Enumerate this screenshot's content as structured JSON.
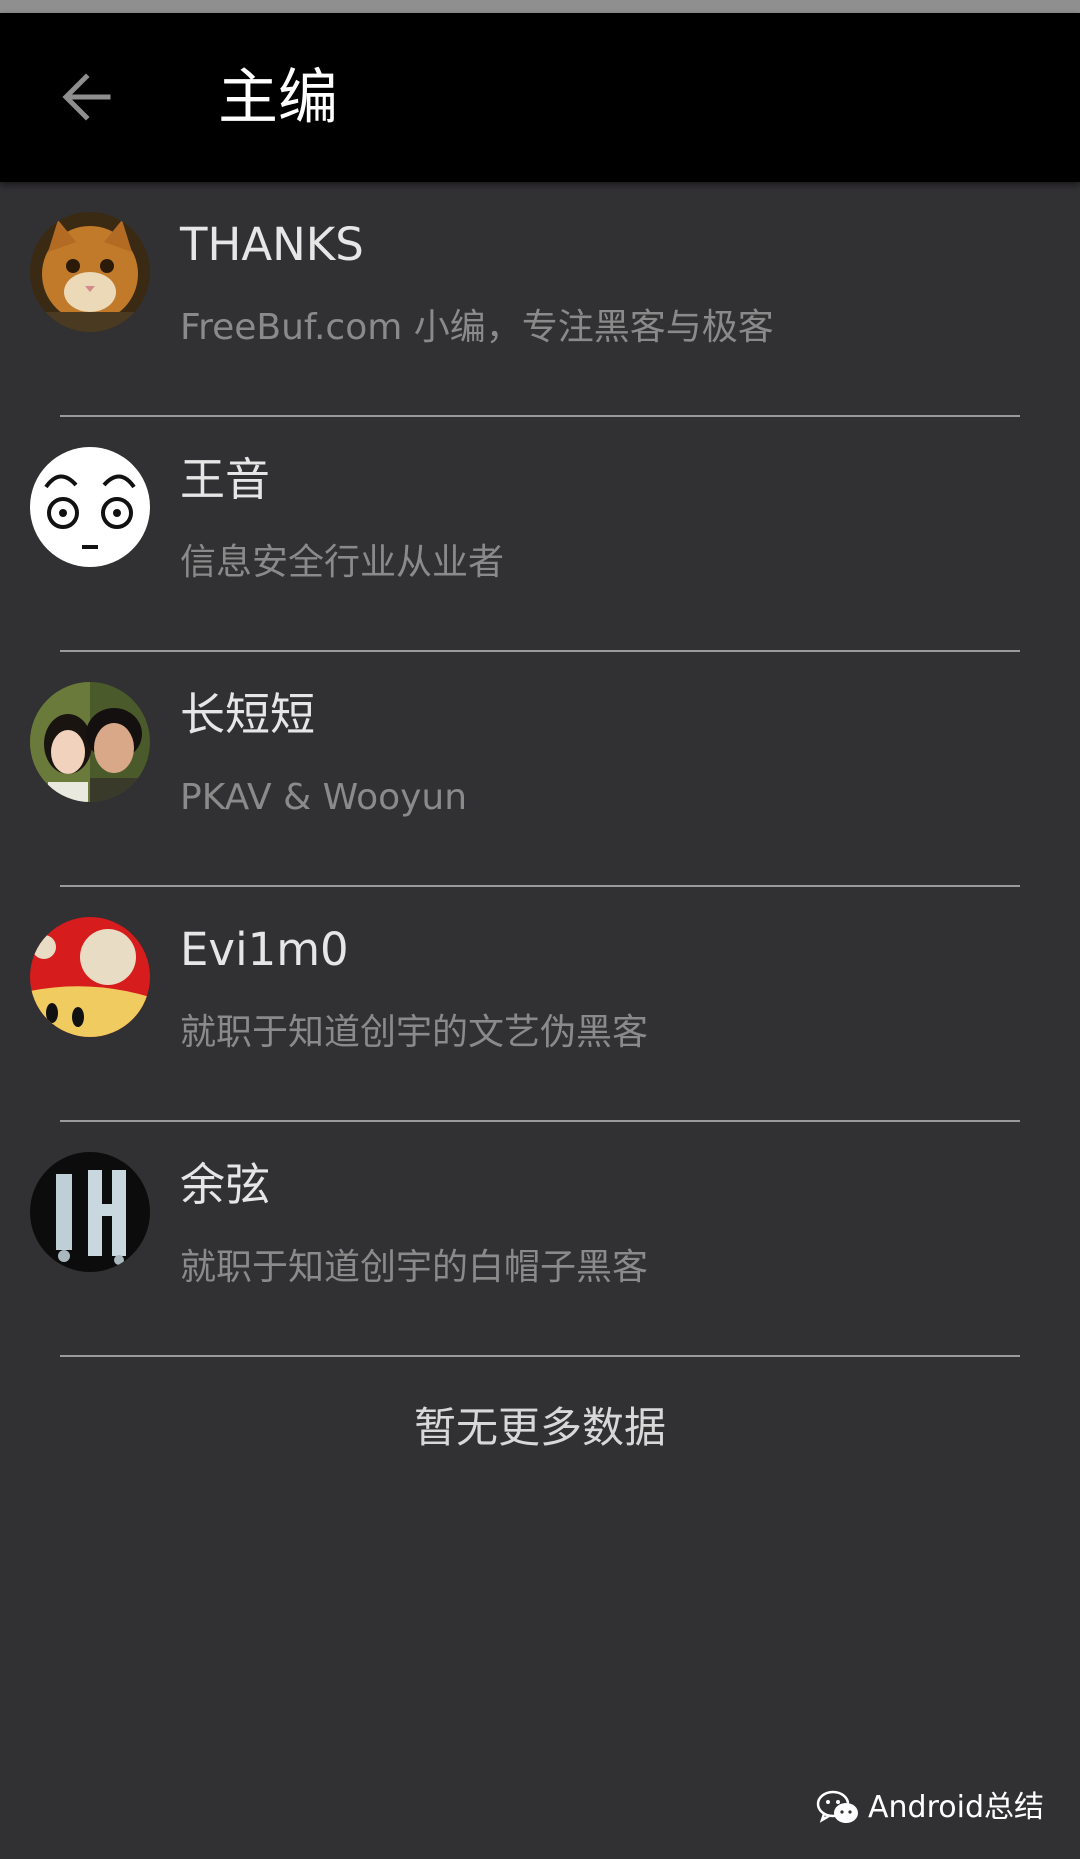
{
  "header": {
    "back_icon": "arrow-left-icon",
    "title": "主编"
  },
  "editors": [
    {
      "name": "THANKS",
      "desc": "FreeBuf.com 小编，专注黑客与极客",
      "avatar": "cat-photo"
    },
    {
      "name": "王音",
      "desc": "信息安全行业从业者",
      "avatar": "staring-face"
    },
    {
      "name": "长短短",
      "desc": "PKAV & Wooyun",
      "avatar": "couple-photo"
    },
    {
      "name": "Evi1m0",
      "desc": "就职于知道创宇的文艺伪黑客",
      "avatar": "mushroom"
    },
    {
      "name": "余弦",
      "desc": "就职于知道创宇的白帽子黑客",
      "avatar": "dark-glyph"
    }
  ],
  "footer": {
    "no_more": "暂无更多数据"
  },
  "watermark": {
    "icon": "wechat-icon",
    "text": "Android总结"
  },
  "colors": {
    "background": "#313033",
    "app_bar": "#000000",
    "name_text": "#e6e6e6",
    "desc_text": "#8a8a8a"
  }
}
